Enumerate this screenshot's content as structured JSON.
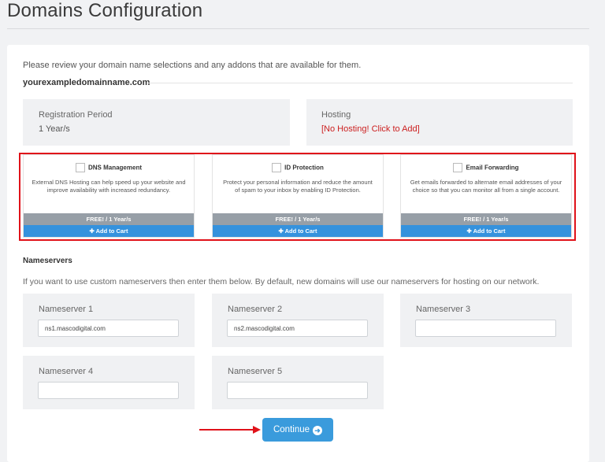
{
  "page": {
    "title": "Domains Configuration"
  },
  "intro_text": "Please review your domain name selections and any addons that are available for them.",
  "domain": "yourexampledomainname.com",
  "registration": {
    "label": "Registration Period",
    "value": "1 Year/s"
  },
  "hosting": {
    "label": "Hosting",
    "value": "[No Hosting! Click to Add]"
  },
  "addons": [
    {
      "name": "DNS Management",
      "description": "External DNS Hosting can help speed up your website and improve availability with increased redundancy.",
      "price": "FREE! / 1 Year/s",
      "button": "Add to Cart"
    },
    {
      "name": "ID Protection",
      "description": "Protect your personal information and reduce the amount of spam to your inbox by enabling ID Protection.",
      "price": "FREE! / 1 Year/s",
      "button": "Add to Cart"
    },
    {
      "name": "Email Forwarding",
      "description": "Get emails forwarded to alternate email addresses of your choice so that you can monitor all from a single account.",
      "price": "FREE! / 1 Year/s",
      "button": "Add to Cart"
    }
  ],
  "nameservers": {
    "heading": "Nameservers",
    "help": "If you want to use custom nameservers then enter them below. By default, new domains will use our nameservers for hosting on our network.",
    "fields": [
      {
        "label": "Nameserver 1",
        "value": "ns1.mascodigital.com"
      },
      {
        "label": "Nameserver 2",
        "value": "ns2.mascodigital.com"
      },
      {
        "label": "Nameserver 3",
        "value": ""
      },
      {
        "label": "Nameserver 4",
        "value": ""
      },
      {
        "label": "Nameserver 5",
        "value": ""
      }
    ]
  },
  "continue_button": {
    "label": "Continue",
    "icon": "arrow-circle-right-icon"
  },
  "colors": {
    "accent_blue": "#3592dd",
    "highlight_red": "#e0121a",
    "price_bar_gray": "#979fa7",
    "link_red": "#cc1f1f"
  }
}
